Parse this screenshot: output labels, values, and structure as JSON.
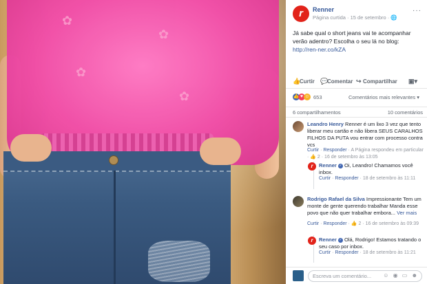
{
  "post": {
    "page_name": "Renner",
    "page_meta": "Página curtida · 15 de setembro · 🌐",
    "text": "Já sabe qual o short jeans vai te acompanhar verão adentro? Escolha o seu lá no blog: ",
    "link": "http://ren-ner.co/kZA",
    "more": "···"
  },
  "actions": {
    "like": "Curtir",
    "comment": "Comentar",
    "share": "Compartilhar"
  },
  "reactions": {
    "count": "653",
    "sort": "Comentários mais relevantes ▾",
    "shares": "6 compartilhamentos",
    "comments": "10 comentários"
  },
  "comments": [
    {
      "author": "Leandro Henry",
      "text": " Renner é um lixo 3 vez que tento liberar meu cartão e não libera SEUS CARALHOS FILHOS DA PUTA vou entrar com processo contra vcs",
      "meta_like": "Curtir",
      "meta_reply": "Responder",
      "meta_rest": " · A Página respondeu em particular · 👍 2 · 16 de setembro às 13:05"
    },
    {
      "author": "Renner",
      "text": " Oi, Leandro! Chamamos você inbox.",
      "meta_like": "Curtir",
      "meta_reply": "Responder",
      "meta_rest": " · 18 de setembro às 11:11"
    },
    {
      "author": "Rodrigo Rafael da Silva",
      "text": " Impressionante Tem um monte de gente querendo trabalhar Manda esse povo que não quer trabalhar embora... ",
      "see_more": "Ver mais",
      "meta_like": "Curtir",
      "meta_reply": "Responder",
      "meta_rest": " · 👍 2 · 16 de setembro às 09:39"
    },
    {
      "author": "Renner",
      "text": " Olá, Rodrigo! Estamos tratando o seu caso por inbox.",
      "meta_like": "Curtir",
      "meta_reply": "Responder",
      "meta_rest": " · 18 de setembro às 11:21"
    }
  ],
  "write": {
    "placeholder": "Escreva um comentário...",
    "icons": "☺ ◉ ▭ ☻"
  },
  "colors": {
    "brand_red": "#e2231a",
    "facebook_blue": "#365899"
  }
}
